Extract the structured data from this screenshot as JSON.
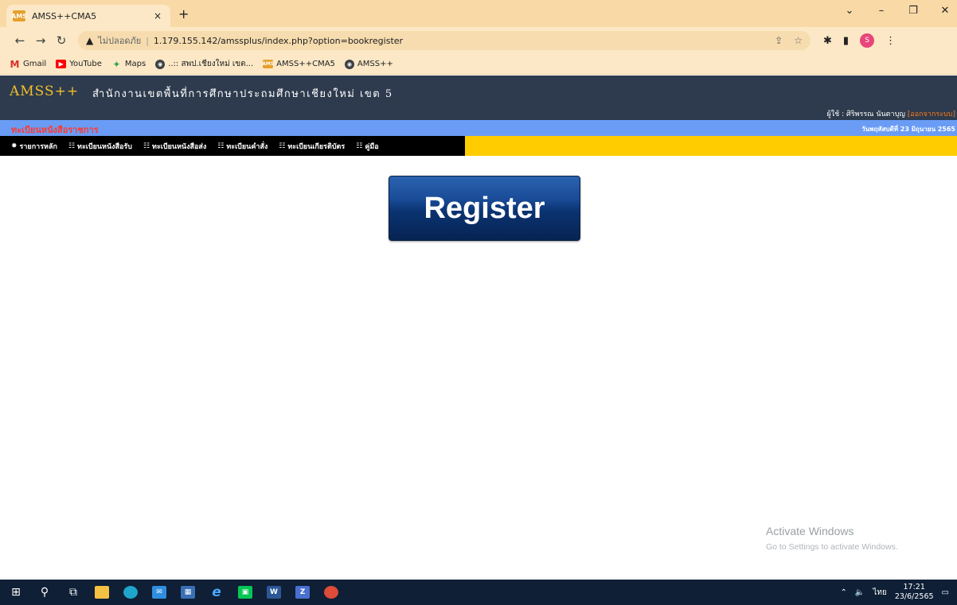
{
  "browser": {
    "tab_title": "AMSS++CMA5",
    "tab_favicon_text": "AMS",
    "tab_close": "×",
    "new_tab": "+",
    "insecure_label": "ไม่ปลอดภัย",
    "url": "1.179.155.142/amssplus/index.php?option=bookregister",
    "profile_initial": "S",
    "bookmarks": [
      {
        "label": "Gmail",
        "icon": "gmail-icon"
      },
      {
        "label": "YouTube",
        "icon": "youtube-icon"
      },
      {
        "label": "Maps",
        "icon": "maps-icon"
      },
      {
        "label": "..:: สพป.เชียงใหม่ เขต...",
        "icon": "globe-icon"
      },
      {
        "label": "AMSS++CMA5",
        "icon": "amss-icon"
      },
      {
        "label": "AMSS++",
        "icon": "globe-icon"
      }
    ]
  },
  "site": {
    "logo": "AMSS++",
    "org_name": "สำนักงานเขตพื้นที่การศึกษาประถมศึกษาเชียงใหม่ เขต 5",
    "user_prefix": "ผู้ใช้ : ศิริพรรณ นันตาบุญ",
    "logout": "[ออกจากระบบ]",
    "module_title": "ทะเบียนหนังสือราชการ",
    "date": "วันพฤหัสบดีที่ 23 มิถุนายน 2565",
    "menu": [
      {
        "label": "รายการหลัก",
        "icon": "home-icon"
      },
      {
        "label": "ทะเบียนหนังสือรับ",
        "icon": "grid-icon"
      },
      {
        "label": "ทะเบียนหนังสือส่ง",
        "icon": "grid-icon"
      },
      {
        "label": "ทะเบียนคำสั่ง",
        "icon": "grid-icon"
      },
      {
        "label": "ทะเบียนเกียรติบัตร",
        "icon": "grid-icon"
      },
      {
        "label": "คู่มือ",
        "icon": "grid-icon"
      }
    ],
    "register_label": "Register"
  },
  "watermark": {
    "title": "Activate Windows",
    "subtitle": "Go to Settings to activate Windows."
  },
  "taskbar": {
    "lang": "ไทย",
    "time": "17:21",
    "date": "23/6/2565"
  }
}
